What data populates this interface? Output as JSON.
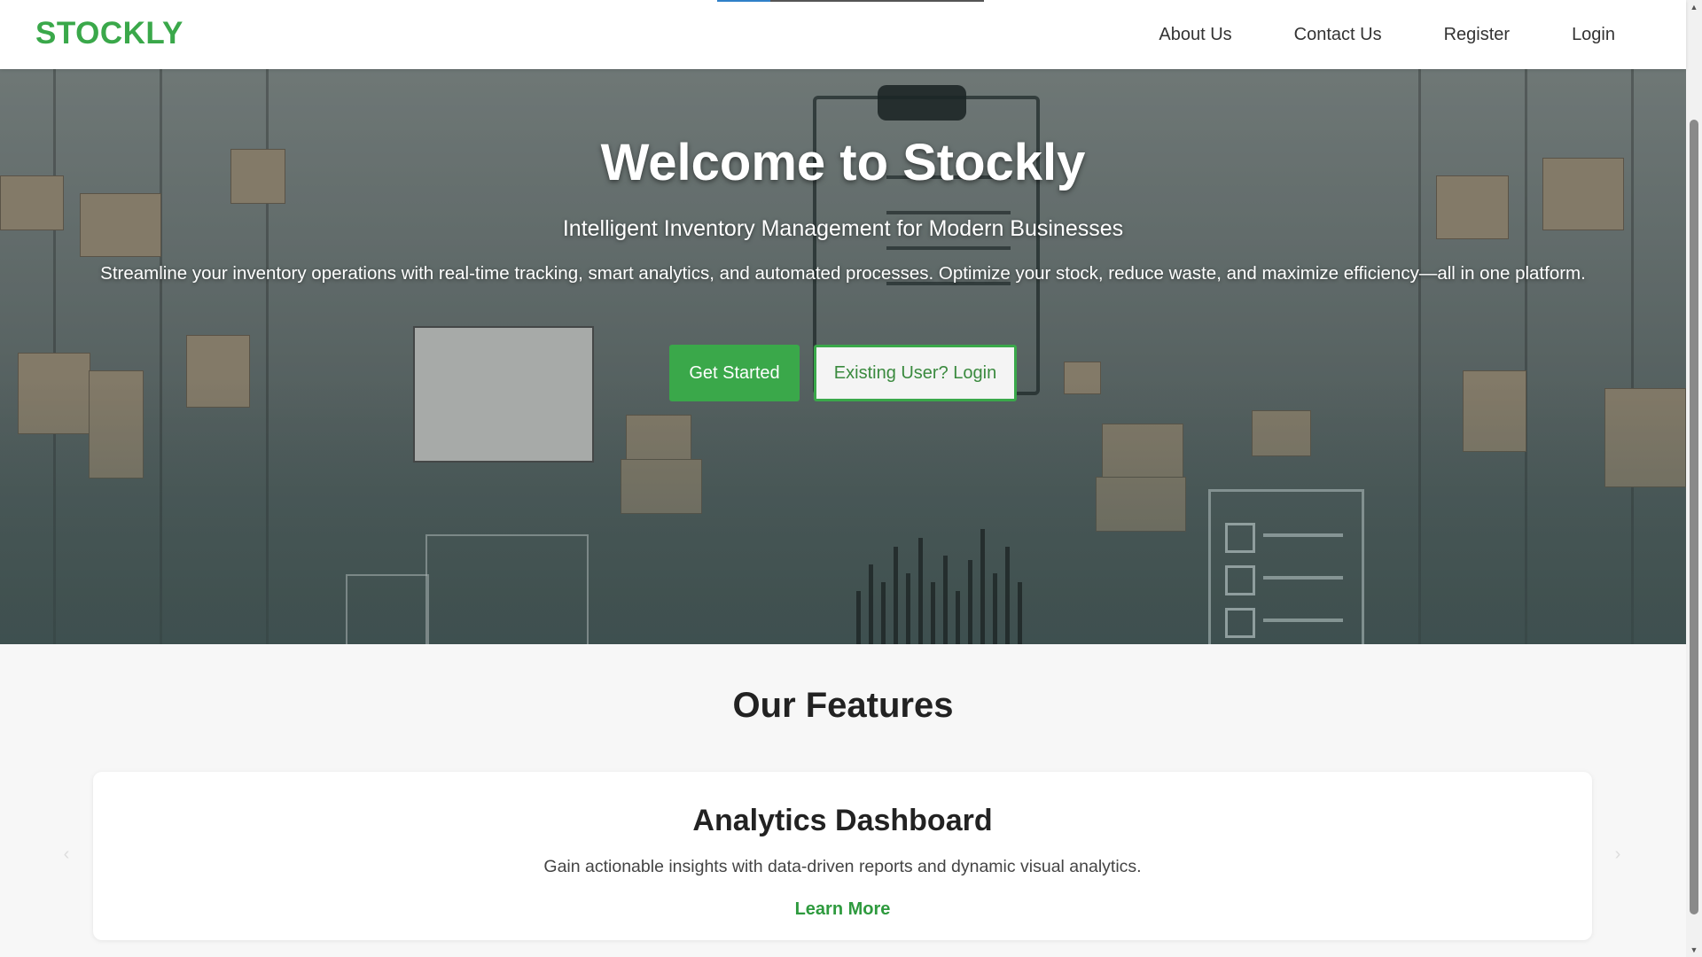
{
  "nav": {
    "brand": "STOCKLY",
    "links": [
      "About Us",
      "Contact Us",
      "Register",
      "Login"
    ]
  },
  "hero": {
    "title": "Welcome to Stockly",
    "subtitle": "Intelligent Inventory Management for Modern Businesses",
    "description": "Streamline your inventory operations with real-time tracking, smart analytics, and automated processes. Optimize your stock, reduce waste, and maximize efficiency—all in one platform.",
    "primary_button": "Get Started",
    "secondary_button": "Existing User? Login"
  },
  "features": {
    "title": "Our Features",
    "card": {
      "title": "Analytics Dashboard",
      "description": "Gain actionable insights with data-driven reports and dynamic visual analytics.",
      "link": "Learn More"
    },
    "prev_icon": "chevron-left-icon",
    "next_icon": "chevron-right-icon"
  },
  "colors": {
    "brand": "#3aa84a",
    "link": "#2e9a3e"
  }
}
